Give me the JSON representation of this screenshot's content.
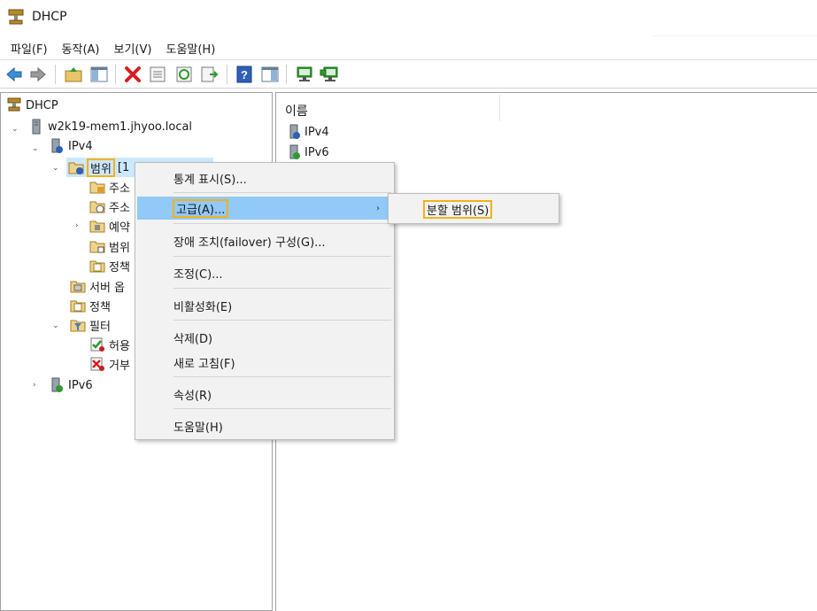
{
  "window": {
    "title": "DHCP"
  },
  "menubar": {
    "items": [
      "파일(F)",
      "동작(A)",
      "보기(V)",
      "도움말(H)"
    ]
  },
  "toolbar": {
    "buttons": [
      "back-icon",
      "forward-icon",
      "up-folder-icon",
      "show-hide-tree-icon",
      "delete-icon",
      "properties-icon",
      "refresh-icon",
      "export-list-icon",
      "help-icon",
      "show-action-pane-icon",
      "server-icon",
      "add-server-icon"
    ]
  },
  "tree": {
    "root": "DHCP",
    "server": "w2k19-mem1.jhyoo.local",
    "ipv4": "IPv4",
    "scope": "범위",
    "scope_suffix": "[1",
    "scope_children": [
      "주소",
      "주소",
      "예약",
      "범위",
      "정책"
    ],
    "server_options": "서버 옵",
    "policies": "정책",
    "filters": "필터",
    "filter_children": [
      "허용",
      "거부"
    ],
    "ipv6": "IPv6"
  },
  "list": {
    "column_name": "이름",
    "items": [
      "IPv4",
      "IPv6"
    ]
  },
  "context_menu": {
    "items": [
      "통계 표시(S)...",
      "고급(A)...",
      "장애 조치(failover) 구성(G)...",
      "조정(C)...",
      "비활성화(E)",
      "삭제(D)",
      "새로 고침(F)",
      "속성(R)",
      "도움말(H)"
    ],
    "active_item": "고급(A)..."
  },
  "submenu": {
    "items": [
      "분할 범위(S)"
    ]
  },
  "colors": {
    "highlight_border": "#f3b21b",
    "menu_active": "#91c9f7",
    "tree_selection": "#cce8ff"
  }
}
